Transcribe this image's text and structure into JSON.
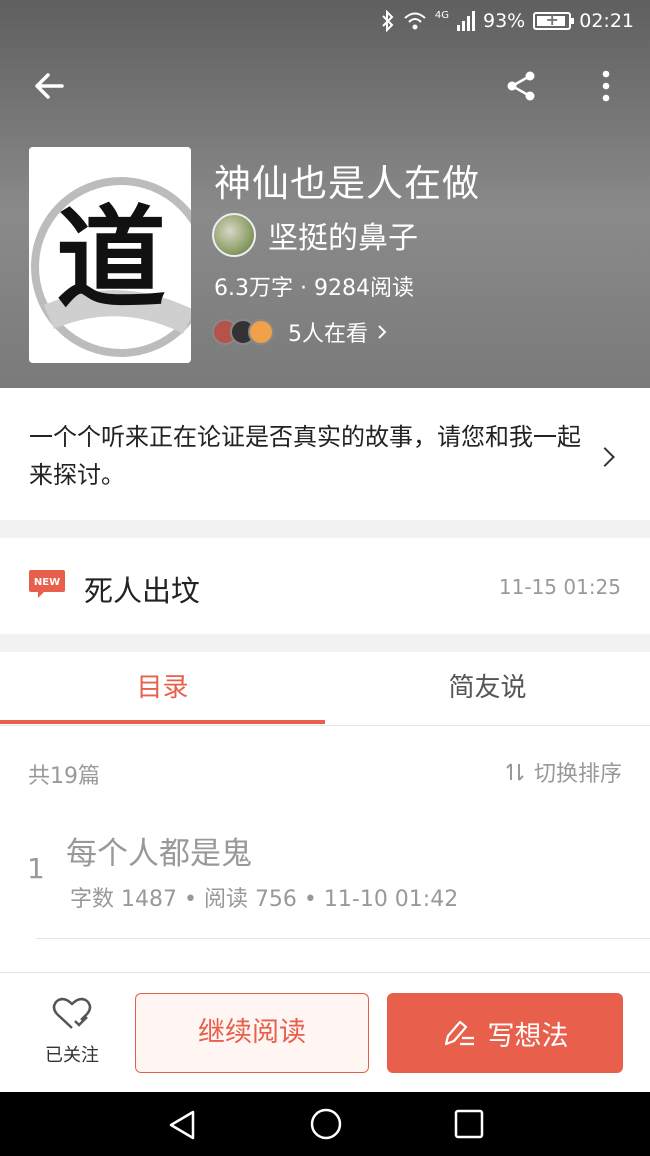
{
  "status_bar": {
    "signal_label": "4G",
    "battery": "93%",
    "time": "02:21"
  },
  "book": {
    "title": "神仙也是人在做",
    "cover_glyph": "道",
    "author": "坚挺的鼻子",
    "stats": "6.3万字 · 9284阅读",
    "watching": "5人在看",
    "intro": "一个个听来正在论证是否真实的故事，请您和我一起来探讨。"
  },
  "latest": {
    "badge": "NEW",
    "title": "死人出坟",
    "time": "11-15 01:25"
  },
  "tabs": [
    {
      "label": "目录",
      "active": true
    },
    {
      "label": "简友说",
      "active": false
    }
  ],
  "toc": {
    "total": "共19篇",
    "sort_label": "切换排序",
    "chapters": [
      {
        "number": "1",
        "title": "每个人都是鬼",
        "meta": "字数 1487 • 阅读 756 • 11-10 01:42"
      }
    ]
  },
  "actions": {
    "follow_label": "已关注",
    "continue_label": "继续阅读",
    "write_label": "写想法"
  },
  "colors": {
    "accent": "#e8604c",
    "header_bg": "#6e6e6e"
  }
}
